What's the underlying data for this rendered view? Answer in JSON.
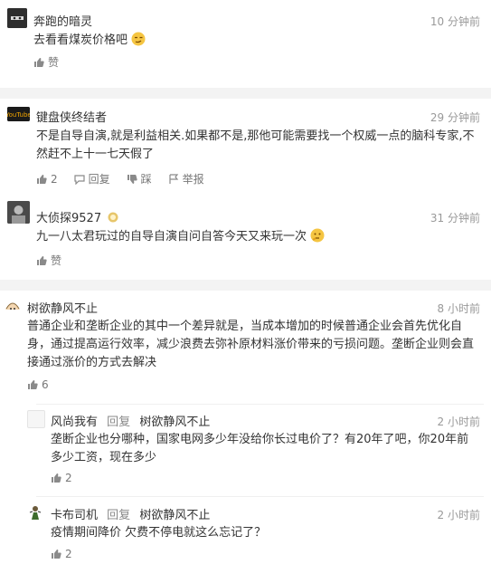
{
  "comments": [
    {
      "user": "奔跑的暗灵",
      "time": "10 分钟前",
      "text": "去看看煤炭价格吧",
      "emoji": "smirk-emoji",
      "like_label": "赞"
    },
    {
      "user": "键盘侠终结者",
      "time": "29 分钟前",
      "text": "不是自导自演,就是利益相关.如果都不是,那他可能需要找一个权威一点的脑科专家,不然赶不上十一七天假了",
      "likes": "2",
      "reply_label": "回复",
      "dislike_label": "踩",
      "report_label": "举报"
    },
    {
      "user": "大侦探9527",
      "time": "31 分钟前",
      "text": "九一八太君玩过的自导自演自问自答今天又来玩一次",
      "emoji": "thinking-emoji",
      "like_label": "赞"
    },
    {
      "user": "树欲静风不止",
      "time": "8 小时前",
      "text": "普通企业和垄断企业的其中一个差异就是，当成本增加的时候普通企业会首先优化自身，通过提高运行效率，减少浪费去弥补原材料涨价带来的亏损问题。垄断企业则会直接通过涨价的方式去解决",
      "likes": "6"
    }
  ],
  "replies": [
    {
      "user": "风尚我有",
      "reply_word": "回复",
      "target": "树欲静风不止",
      "time": "2 小时前",
      "text": "垄断企业也分哪种，国家电网多少年没给你长过电价了？有20年了吧，你20年前多少工资，现在多少",
      "likes": "2"
    },
    {
      "user": "卡布司机",
      "reply_word": "回复",
      "target": "树欲静风不止",
      "time": "2 小时前",
      "text": "疫情期间降价 欠费不停电就这么忘记了？",
      "likes": "2"
    }
  ]
}
